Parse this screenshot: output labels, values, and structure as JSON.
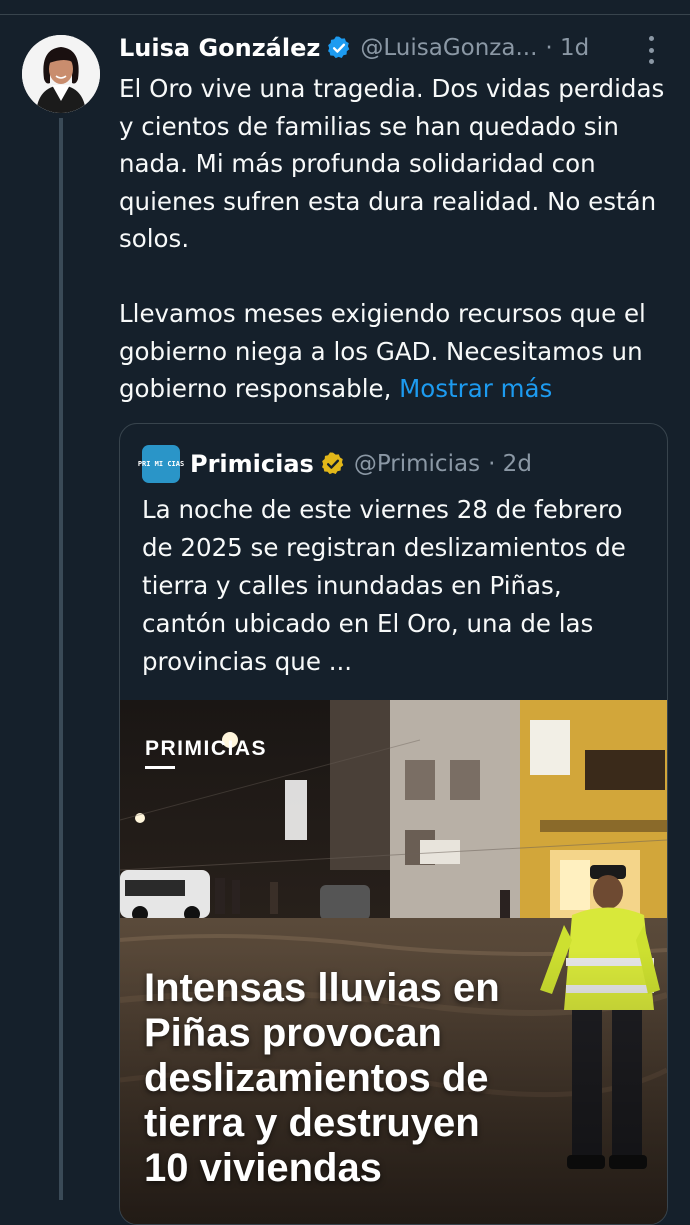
{
  "tweet": {
    "author_name": "Luisa González",
    "author_handle": "@LuisaGonza...",
    "timestamp": "· 1d",
    "text_paragraphs": [
      "El Oro vive una tragedia. Dos vidas perdidas y cientos de familias se han quedado sin nada. Mi más profunda solidaridad con quienes sufren esta dura realidad. No están solos.",
      "Llevamos meses exigiendo recursos que el gobierno niega a los GAD. Necesitamos un gobierno responsable, "
    ],
    "show_more_label": "Mostrar más"
  },
  "quote": {
    "logo_text": "PRI MI CIAS",
    "author_name": "Primicias",
    "author_handle": "@Primicias",
    "timestamp": "· 2d",
    "text": "La noche de este viernes 28 de febrero de 2025 se registran deslizamientos de tierra y calles inundadas en Piñas, cantón ubicado en El Oro, una de las provincias que ...",
    "media": {
      "brand": "PRIMICIAS",
      "headline_lines": [
        "Intensas lluvias en",
        "Piñas provocan",
        "deslizamientos de",
        "tierra y destruyen",
        "10 viviendas"
      ]
    }
  },
  "colors": {
    "background": "#15202b",
    "link": "#1d9bf0",
    "verified_blue": "#1d9bf0",
    "verified_gold": "#e2b719",
    "muted_text": "#8b98a5"
  },
  "icons": {
    "verified": "blue-verified-badge-icon",
    "verified_org": "gold-verified-badge-icon",
    "more": "more-options-icon"
  }
}
